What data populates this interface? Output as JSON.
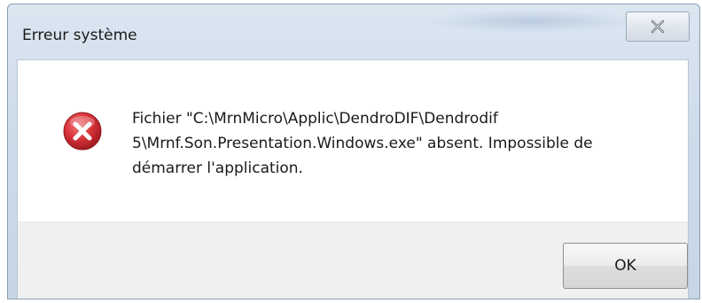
{
  "dialog": {
    "title": "Erreur système",
    "close_icon": "close-icon",
    "message_icon": "error-icon",
    "message_lines": [
      "Fichier \"C:\\MrnMicro\\Applic\\DendroDIF\\Dendrodif",
      "5\\Mrnf.Son.Presentation.Windows.exe\" absent. Impossible de",
      "démarrer l'application."
    ],
    "ok_label": "OK"
  },
  "colors": {
    "error_red": "#d8343a",
    "titlebar": "#cfdcea",
    "footer": "#f0f0f0"
  }
}
